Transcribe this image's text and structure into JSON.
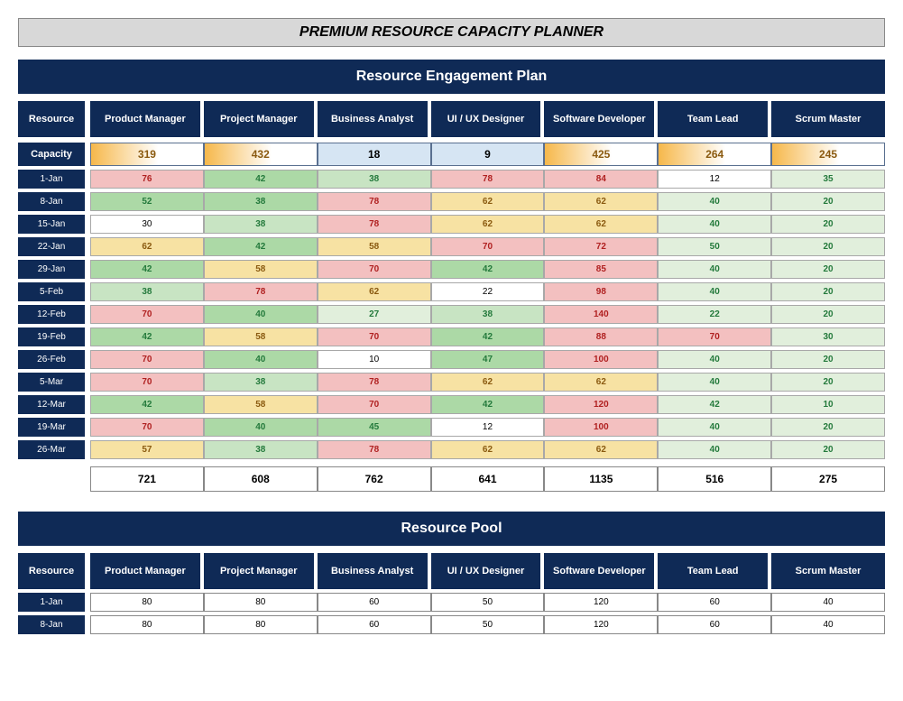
{
  "title": "PREMIUM RESOURCE CAPACITY PLANNER",
  "section1": "Resource Engagement Plan",
  "section2": "Resource Pool",
  "header": {
    "resource": "Resource",
    "cols": [
      "Product Manager",
      "Project Manager",
      "Business Analyst",
      "UI / UX Designer",
      "Software Developer",
      "Team Lead",
      "Scrum Master"
    ]
  },
  "capacity": {
    "label": "Capacity",
    "cells": [
      {
        "val": "319",
        "style": "amber"
      },
      {
        "val": "432",
        "style": "amber"
      },
      {
        "val": "18",
        "style": "plain"
      },
      {
        "val": "9",
        "style": "plain"
      },
      {
        "val": "425",
        "style": "amber"
      },
      {
        "val": "264",
        "style": "amber"
      },
      {
        "val": "245",
        "style": "amber"
      }
    ]
  },
  "rows": [
    {
      "date": "1-Jan",
      "cells": [
        [
          "76",
          "red"
        ],
        [
          "42",
          "green-d"
        ],
        [
          "38",
          "green-m"
        ],
        [
          "78",
          "red"
        ],
        [
          "84",
          "red"
        ],
        [
          "12",
          "white"
        ],
        [
          "35",
          "green-l"
        ]
      ]
    },
    {
      "date": "8-Jan",
      "cells": [
        [
          "52",
          "green-d"
        ],
        [
          "38",
          "green-d"
        ],
        [
          "78",
          "red"
        ],
        [
          "62",
          "amber"
        ],
        [
          "62",
          "amber"
        ],
        [
          "40",
          "green-l"
        ],
        [
          "20",
          "green-l"
        ]
      ]
    },
    {
      "date": "15-Jan",
      "cells": [
        [
          "30",
          "white"
        ],
        [
          "38",
          "green-m"
        ],
        [
          "78",
          "red"
        ],
        [
          "62",
          "amber"
        ],
        [
          "62",
          "amber"
        ],
        [
          "40",
          "green-l"
        ],
        [
          "20",
          "green-l"
        ]
      ]
    },
    {
      "date": "22-Jan",
      "cells": [
        [
          "62",
          "amber"
        ],
        [
          "42",
          "green-d"
        ],
        [
          "58",
          "amber"
        ],
        [
          "70",
          "red"
        ],
        [
          "72",
          "red"
        ],
        [
          "50",
          "green-l"
        ],
        [
          "20",
          "green-l"
        ]
      ]
    },
    {
      "date": "29-Jan",
      "cells": [
        [
          "42",
          "green-d"
        ],
        [
          "58",
          "amber"
        ],
        [
          "70",
          "red"
        ],
        [
          "42",
          "green-d"
        ],
        [
          "85",
          "red"
        ],
        [
          "40",
          "green-l"
        ],
        [
          "20",
          "green-l"
        ]
      ]
    },
    {
      "date": "5-Feb",
      "cells": [
        [
          "38",
          "green-m"
        ],
        [
          "78",
          "red"
        ],
        [
          "62",
          "amber"
        ],
        [
          "22",
          "white"
        ],
        [
          "98",
          "red"
        ],
        [
          "40",
          "green-l"
        ],
        [
          "20",
          "green-l"
        ]
      ]
    },
    {
      "date": "12-Feb",
      "cells": [
        [
          "70",
          "red"
        ],
        [
          "40",
          "green-d"
        ],
        [
          "27",
          "green-l"
        ],
        [
          "38",
          "green-m"
        ],
        [
          "140",
          "red"
        ],
        [
          "22",
          "green-l"
        ],
        [
          "20",
          "green-l"
        ]
      ]
    },
    {
      "date": "19-Feb",
      "cells": [
        [
          "42",
          "green-d"
        ],
        [
          "58",
          "amber"
        ],
        [
          "70",
          "red"
        ],
        [
          "42",
          "green-d"
        ],
        [
          "88",
          "red"
        ],
        [
          "70",
          "red"
        ],
        [
          "30",
          "green-l"
        ]
      ]
    },
    {
      "date": "26-Feb",
      "cells": [
        [
          "70",
          "red"
        ],
        [
          "40",
          "green-d"
        ],
        [
          "10",
          "white"
        ],
        [
          "47",
          "green-d"
        ],
        [
          "100",
          "red"
        ],
        [
          "40",
          "green-l"
        ],
        [
          "20",
          "green-l"
        ]
      ]
    },
    {
      "date": "5-Mar",
      "cells": [
        [
          "70",
          "red"
        ],
        [
          "38",
          "green-m"
        ],
        [
          "78",
          "red"
        ],
        [
          "62",
          "amber"
        ],
        [
          "62",
          "amber"
        ],
        [
          "40",
          "green-l"
        ],
        [
          "20",
          "green-l"
        ]
      ]
    },
    {
      "date": "12-Mar",
      "cells": [
        [
          "42",
          "green-d"
        ],
        [
          "58",
          "amber"
        ],
        [
          "70",
          "red"
        ],
        [
          "42",
          "green-d"
        ],
        [
          "120",
          "red"
        ],
        [
          "42",
          "green-l"
        ],
        [
          "10",
          "green-l"
        ]
      ]
    },
    {
      "date": "19-Mar",
      "cells": [
        [
          "70",
          "red"
        ],
        [
          "40",
          "green-d"
        ],
        [
          "45",
          "green-d"
        ],
        [
          "12",
          "white"
        ],
        [
          "100",
          "red"
        ],
        [
          "40",
          "green-l"
        ],
        [
          "20",
          "green-l"
        ]
      ]
    },
    {
      "date": "26-Mar",
      "cells": [
        [
          "57",
          "amber"
        ],
        [
          "38",
          "green-m"
        ],
        [
          "78",
          "red"
        ],
        [
          "62",
          "amber"
        ],
        [
          "62",
          "amber"
        ],
        [
          "40",
          "green-l"
        ],
        [
          "20",
          "green-l"
        ]
      ]
    }
  ],
  "totals": [
    "721",
    "608",
    "762",
    "641",
    "1135",
    "516",
    "275"
  ],
  "pool_rows": [
    {
      "date": "1-Jan",
      "cells": [
        "80",
        "80",
        "60",
        "50",
        "120",
        "60",
        "40"
      ]
    },
    {
      "date": "8-Jan",
      "cells": [
        "80",
        "80",
        "60",
        "50",
        "120",
        "60",
        "40"
      ]
    }
  ],
  "chart_data": {
    "type": "table",
    "title": "Resource Engagement Plan",
    "columns": [
      "Product Manager",
      "Project Manager",
      "Business Analyst",
      "UI / UX Designer",
      "Software Developer",
      "Team Lead",
      "Scrum Master"
    ],
    "capacity": [
      319,
      432,
      18,
      9,
      425,
      264,
      245
    ],
    "rows": [
      {
        "date": "1-Jan",
        "values": [
          76,
          42,
          38,
          78,
          84,
          12,
          35
        ]
      },
      {
        "date": "8-Jan",
        "values": [
          52,
          38,
          78,
          62,
          62,
          40,
          20
        ]
      },
      {
        "date": "15-Jan",
        "values": [
          30,
          38,
          78,
          62,
          62,
          40,
          20
        ]
      },
      {
        "date": "22-Jan",
        "values": [
          62,
          42,
          58,
          70,
          72,
          50,
          20
        ]
      },
      {
        "date": "29-Jan",
        "values": [
          42,
          58,
          70,
          42,
          85,
          40,
          20
        ]
      },
      {
        "date": "5-Feb",
        "values": [
          38,
          78,
          62,
          22,
          98,
          40,
          20
        ]
      },
      {
        "date": "12-Feb",
        "values": [
          70,
          40,
          27,
          38,
          140,
          22,
          20
        ]
      },
      {
        "date": "19-Feb",
        "values": [
          42,
          58,
          70,
          42,
          88,
          70,
          30
        ]
      },
      {
        "date": "26-Feb",
        "values": [
          70,
          40,
          10,
          47,
          100,
          40,
          20
        ]
      },
      {
        "date": "5-Mar",
        "values": [
          70,
          38,
          78,
          62,
          62,
          40,
          20
        ]
      },
      {
        "date": "12-Mar",
        "values": [
          42,
          58,
          70,
          42,
          120,
          42,
          10
        ]
      },
      {
        "date": "19-Mar",
        "values": [
          70,
          40,
          45,
          12,
          100,
          40,
          20
        ]
      },
      {
        "date": "26-Mar",
        "values": [
          57,
          38,
          78,
          62,
          62,
          40,
          20
        ]
      }
    ],
    "totals": [
      721,
      608,
      762,
      641,
      1135,
      516,
      275
    ],
    "pool_title": "Resource Pool",
    "pool_rows": [
      {
        "date": "1-Jan",
        "values": [
          80,
          80,
          60,
          50,
          120,
          60,
          40
        ]
      },
      {
        "date": "8-Jan",
        "values": [
          80,
          80,
          60,
          50,
          120,
          60,
          40
        ]
      }
    ]
  }
}
